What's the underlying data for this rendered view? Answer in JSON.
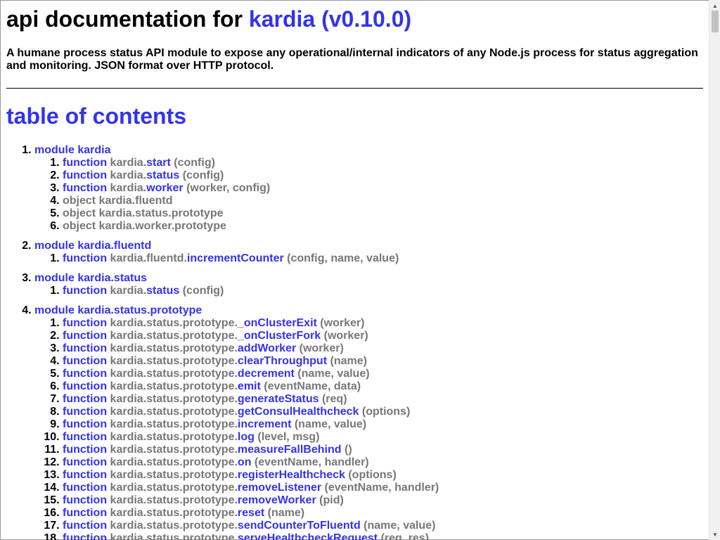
{
  "header": {
    "title_prefix": "api documentation for",
    "title_link": "kardia (v0.10.0)",
    "description": "A humane process status API module to expose any operational/internal indicators of any Node.js process for status aggregation and monitoring. JSON format over HTTP protocol."
  },
  "toc": {
    "heading": "table of contents",
    "modules": [
      {
        "label": "module kardia",
        "members": [
          {
            "kind": "function",
            "prefix": "kardia.",
            "name": "start",
            "args": "(config)"
          },
          {
            "kind": "function",
            "prefix": "kardia.",
            "name": "status",
            "args": "(config)"
          },
          {
            "kind": "function",
            "prefix": "kardia.",
            "name": "worker",
            "args": "(worker, config)"
          },
          {
            "kind": "object",
            "text": "object kardia.fluentd"
          },
          {
            "kind": "object",
            "text": "object kardia.status.prototype"
          },
          {
            "kind": "object",
            "text": "object kardia.worker.prototype"
          }
        ]
      },
      {
        "label": "module kardia.fluentd",
        "members": [
          {
            "kind": "function",
            "prefix": "kardia.fluentd.",
            "name": "incrementCounter",
            "args": "(config, name, value)"
          }
        ]
      },
      {
        "label": "module kardia.status",
        "members": [
          {
            "kind": "function",
            "prefix": "kardia.",
            "name": "status",
            "args": "(config)"
          }
        ]
      },
      {
        "label": "module kardia.status.prototype",
        "members": [
          {
            "kind": "function",
            "prefix": "kardia.status.prototype.",
            "name": "_onClusterExit",
            "args": "(worker)"
          },
          {
            "kind": "function",
            "prefix": "kardia.status.prototype.",
            "name": "_onClusterFork",
            "args": "(worker)"
          },
          {
            "kind": "function",
            "prefix": "kardia.status.prototype.",
            "name": "addWorker",
            "args": "(worker)"
          },
          {
            "kind": "function",
            "prefix": "kardia.status.prototype.",
            "name": "clearThroughput",
            "args": "(name)"
          },
          {
            "kind": "function",
            "prefix": "kardia.status.prototype.",
            "name": "decrement",
            "args": "(name, value)"
          },
          {
            "kind": "function",
            "prefix": "kardia.status.prototype.",
            "name": "emit",
            "args": "(eventName, data)"
          },
          {
            "kind": "function",
            "prefix": "kardia.status.prototype.",
            "name": "generateStatus",
            "args": "(req)"
          },
          {
            "kind": "function",
            "prefix": "kardia.status.prototype.",
            "name": "getConsulHealthcheck",
            "args": "(options)"
          },
          {
            "kind": "function",
            "prefix": "kardia.status.prototype.",
            "name": "increment",
            "args": "(name, value)"
          },
          {
            "kind": "function",
            "prefix": "kardia.status.prototype.",
            "name": "log",
            "args": "(level, msg)"
          },
          {
            "kind": "function",
            "prefix": "kardia.status.prototype.",
            "name": "measureFallBehind",
            "args": "()"
          },
          {
            "kind": "function",
            "prefix": "kardia.status.prototype.",
            "name": "on",
            "args": "(eventName, handler)"
          },
          {
            "kind": "function",
            "prefix": "kardia.status.prototype.",
            "name": "registerHealthcheck",
            "args": "(options)"
          },
          {
            "kind": "function",
            "prefix": "kardia.status.prototype.",
            "name": "removeListener",
            "args": "(eventName, handler)"
          },
          {
            "kind": "function",
            "prefix": "kardia.status.prototype.",
            "name": "removeWorker",
            "args": "(pid)"
          },
          {
            "kind": "function",
            "prefix": "kardia.status.prototype.",
            "name": "reset",
            "args": "(name)"
          },
          {
            "kind": "function",
            "prefix": "kardia.status.prototype.",
            "name": "sendCounterToFluentd",
            "args": "(name, value)"
          },
          {
            "kind": "function",
            "prefix": "kardia.status.prototype.",
            "name": "serveHealthcheckRequest",
            "args": "(req, res)"
          }
        ]
      }
    ]
  },
  "colors": {
    "link": "#3333ee",
    "muted": "#777777",
    "text": "#000000"
  },
  "icons": {
    "scroll_up": "triangle-up-icon",
    "scroll_down": "triangle-down-icon"
  }
}
